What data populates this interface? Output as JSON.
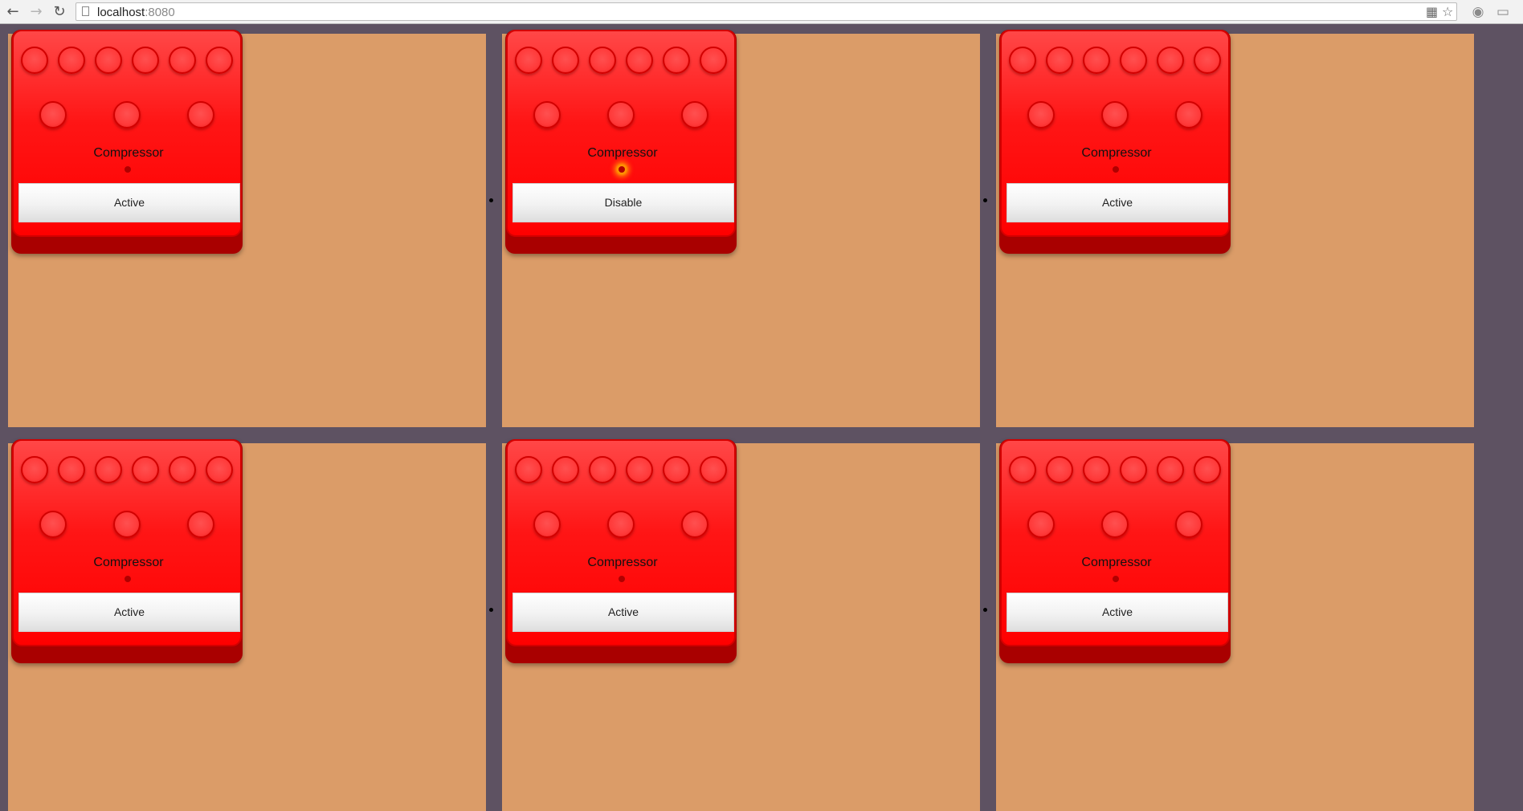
{
  "browser": {
    "url_host": "localhost",
    "url_port": ":8080",
    "icons": [
      "back-icon",
      "forward-icon",
      "reload-icon",
      "page-icon",
      "reader-icon",
      "bookmark-star-icon",
      "extension-icon",
      "cast-icon"
    ]
  },
  "pedals": [
    {
      "name": "Compressor",
      "button_label": "Active",
      "led_on": false
    },
    {
      "name": "Compressor",
      "button_label": "Disable",
      "led_on": true
    },
    {
      "name": "Compressor",
      "button_label": "Active",
      "led_on": false
    },
    {
      "name": "Compressor",
      "button_label": "Active",
      "led_on": false
    },
    {
      "name": "Compressor",
      "button_label": "Active",
      "led_on": false
    },
    {
      "name": "Compressor",
      "button_label": "Active",
      "led_on": false
    }
  ],
  "colors": {
    "background": "#5e5262",
    "panel": "#db9c68",
    "pedal_red": "#ff0000"
  }
}
